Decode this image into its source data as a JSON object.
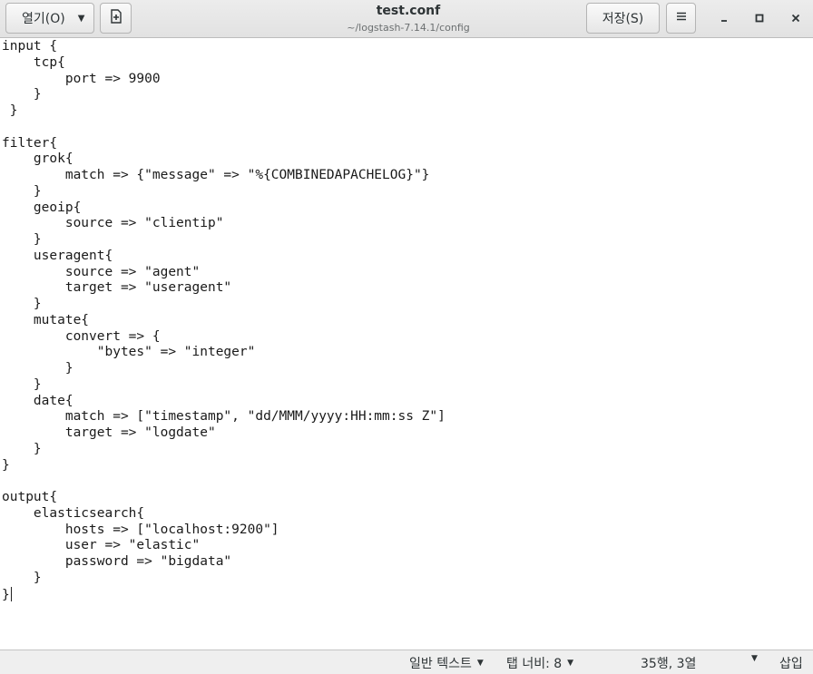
{
  "header": {
    "open_label": "열기(O)",
    "title": "test.conf",
    "path": "~/logstash-7.14.1/config",
    "save_label": "저장(S)"
  },
  "editor": {
    "lines": [
      "input {",
      "    tcp{",
      "        port => 9900",
      "    }",
      " }",
      "",
      "filter{",
      "    grok{",
      "        match => {\"message\" => \"%{COMBINEDAPACHELOG}\"}",
      "    }",
      "    geoip{",
      "        source => \"clientip\"",
      "    }",
      "    useragent{",
      "        source => \"agent\"",
      "        target => \"useragent\"",
      "    }",
      "    mutate{",
      "        convert => {",
      "            \"bytes\" => \"integer\"",
      "        }",
      "    }",
      "    date{",
      "        match => [\"timestamp\", \"dd/MMM/yyyy:HH:mm:ss Z\"]",
      "        target => \"logdate\"",
      "    }",
      "}",
      "",
      "output{",
      "    elasticsearch{",
      "        hosts => [\"localhost:9200\"]",
      "        user => \"elastic\"",
      "        password => \"bigdata\"",
      "    }",
      "}"
    ]
  },
  "statusbar": {
    "language": "일반 텍스트",
    "tab_width": "탭 너비: 8",
    "position": "35행, 3열",
    "mode": "삽입"
  },
  "icons": {
    "open_caret": "caret-down-icon",
    "new_document": "new-document-icon",
    "menu": "hamburger-menu-icon",
    "minimize": "minimize-icon",
    "maximize": "maximize-icon",
    "close": "close-icon"
  }
}
